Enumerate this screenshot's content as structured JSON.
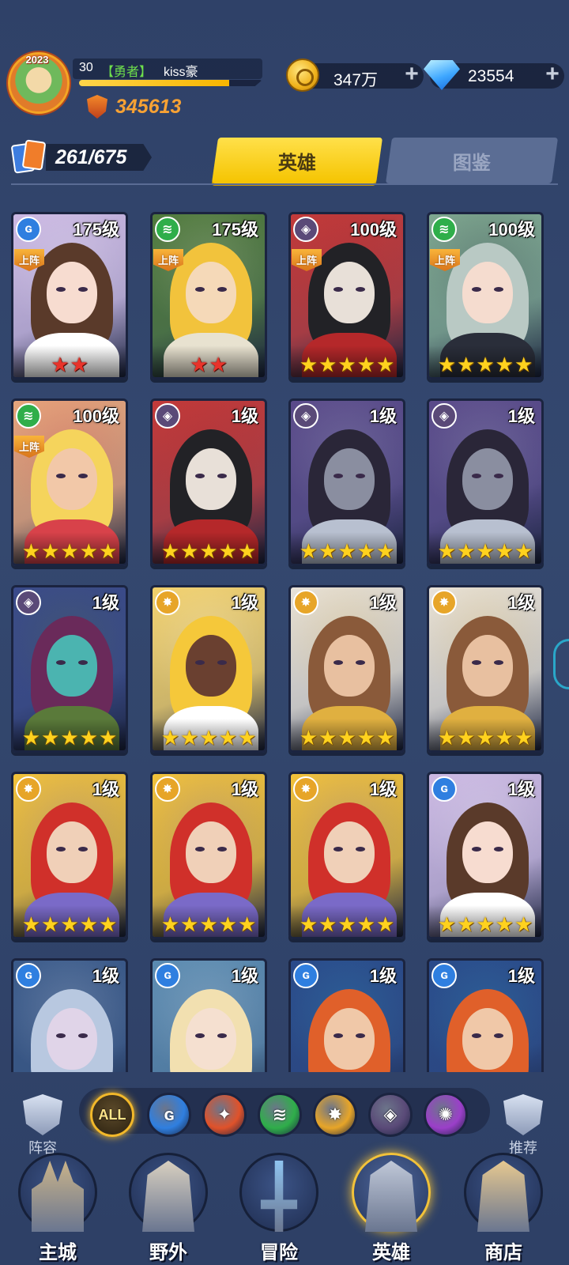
{
  "player": {
    "avatar_badge": "2023",
    "level": "30",
    "tag": "【勇者】",
    "name": "kiss豪",
    "exp_fraction": 0.82,
    "power": "345613"
  },
  "resources": {
    "gold": "347万",
    "gems": "23554",
    "gold_add_label": "+",
    "gem_add_label": "+"
  },
  "collection_count": "261/675",
  "tabs": [
    {
      "label": "英雄",
      "active": true
    },
    {
      "label": "图鉴",
      "active": false
    }
  ],
  "deploy_label": "上阵",
  "heroes": [
    {
      "level": "175级",
      "element": "water",
      "deployed": true,
      "stars": 2,
      "star_color": "red",
      "art": "girl-white"
    },
    {
      "level": "175级",
      "element": "wind",
      "deployed": true,
      "stars": 2,
      "star_color": "red",
      "art": "blonde-child"
    },
    {
      "level": "100级",
      "element": "shadow",
      "deployed": true,
      "stars": 5,
      "star_color": "gold",
      "art": "skull-knight"
    },
    {
      "level": "100级",
      "element": "wind",
      "deployed": true,
      "stars": 5,
      "star_color": "gold",
      "art": "elf-girl"
    },
    {
      "level": "100级",
      "element": "wind",
      "deployed": true,
      "stars": 5,
      "star_color": "gold",
      "art": "blonde-woman"
    },
    {
      "level": "1级",
      "element": "shadow",
      "deployed": false,
      "stars": 5,
      "star_color": "gold",
      "art": "skull-knight"
    },
    {
      "level": "1级",
      "element": "shadow",
      "deployed": false,
      "stars": 5,
      "star_color": "gold",
      "art": "gunslinger"
    },
    {
      "level": "1级",
      "element": "shadow",
      "deployed": false,
      "stars": 5,
      "star_color": "gold",
      "art": "gunslinger"
    },
    {
      "level": "1级",
      "element": "shadow",
      "deployed": false,
      "stars": 5,
      "star_color": "gold",
      "art": "plague-doctor"
    },
    {
      "level": "1级",
      "element": "light",
      "deployed": false,
      "stars": 5,
      "star_color": "gold",
      "art": "golden-goddess"
    },
    {
      "level": "1级",
      "element": "light",
      "deployed": false,
      "stars": 5,
      "star_color": "gold",
      "art": "paladin"
    },
    {
      "level": "1级",
      "element": "light",
      "deployed": false,
      "stars": 5,
      "star_color": "gold",
      "art": "paladin"
    },
    {
      "level": "1级",
      "element": "light",
      "deployed": false,
      "stars": 5,
      "star_color": "gold",
      "art": "valkyrie"
    },
    {
      "level": "1级",
      "element": "light",
      "deployed": false,
      "stars": 5,
      "star_color": "gold",
      "art": "valkyrie"
    },
    {
      "level": "1级",
      "element": "light",
      "deployed": false,
      "stars": 5,
      "star_color": "gold",
      "art": "valkyrie"
    },
    {
      "level": "1级",
      "element": "water",
      "deployed": false,
      "stars": 5,
      "star_color": "gold",
      "art": "girl-white"
    },
    {
      "level": "1级",
      "element": "water",
      "deployed": false,
      "stars": 5,
      "star_color": "gold",
      "art": "hooded-elf"
    },
    {
      "level": "1级",
      "element": "water",
      "deployed": false,
      "stars": 5,
      "star_color": "gold",
      "art": "veiled-blonde"
    },
    {
      "level": "1级",
      "element": "water",
      "deployed": false,
      "stars": 5,
      "star_color": "gold",
      "art": "red-hair-warrior"
    },
    {
      "level": "1级",
      "element": "water",
      "deployed": false,
      "stars": 5,
      "star_color": "gold",
      "art": "red-hair-warrior"
    }
  ],
  "filter": {
    "lineup_label": "阵容",
    "recommend_label": "推荐",
    "all_label": "ALL",
    "elements": [
      "water",
      "fire",
      "wind",
      "light",
      "shadow",
      "arcane"
    ]
  },
  "colors": {
    "water": "#2f7fe0",
    "fire": "#e0522a",
    "wind": "#2fae4a",
    "light": "#e7a528",
    "shadow": "#5a4a78",
    "arcane": "#9b3fc9",
    "accent": "#f5c400"
  },
  "nav": [
    {
      "label": "主城",
      "icon": "castle-icon",
      "active": false
    },
    {
      "label": "野外",
      "icon": "portal-icon",
      "active": false
    },
    {
      "label": "冒险",
      "icon": "sword-icon",
      "active": false
    },
    {
      "label": "英雄",
      "icon": "knight-helmet-icon",
      "active": true
    },
    {
      "label": "商店",
      "icon": "shop-icon",
      "active": false
    }
  ]
}
